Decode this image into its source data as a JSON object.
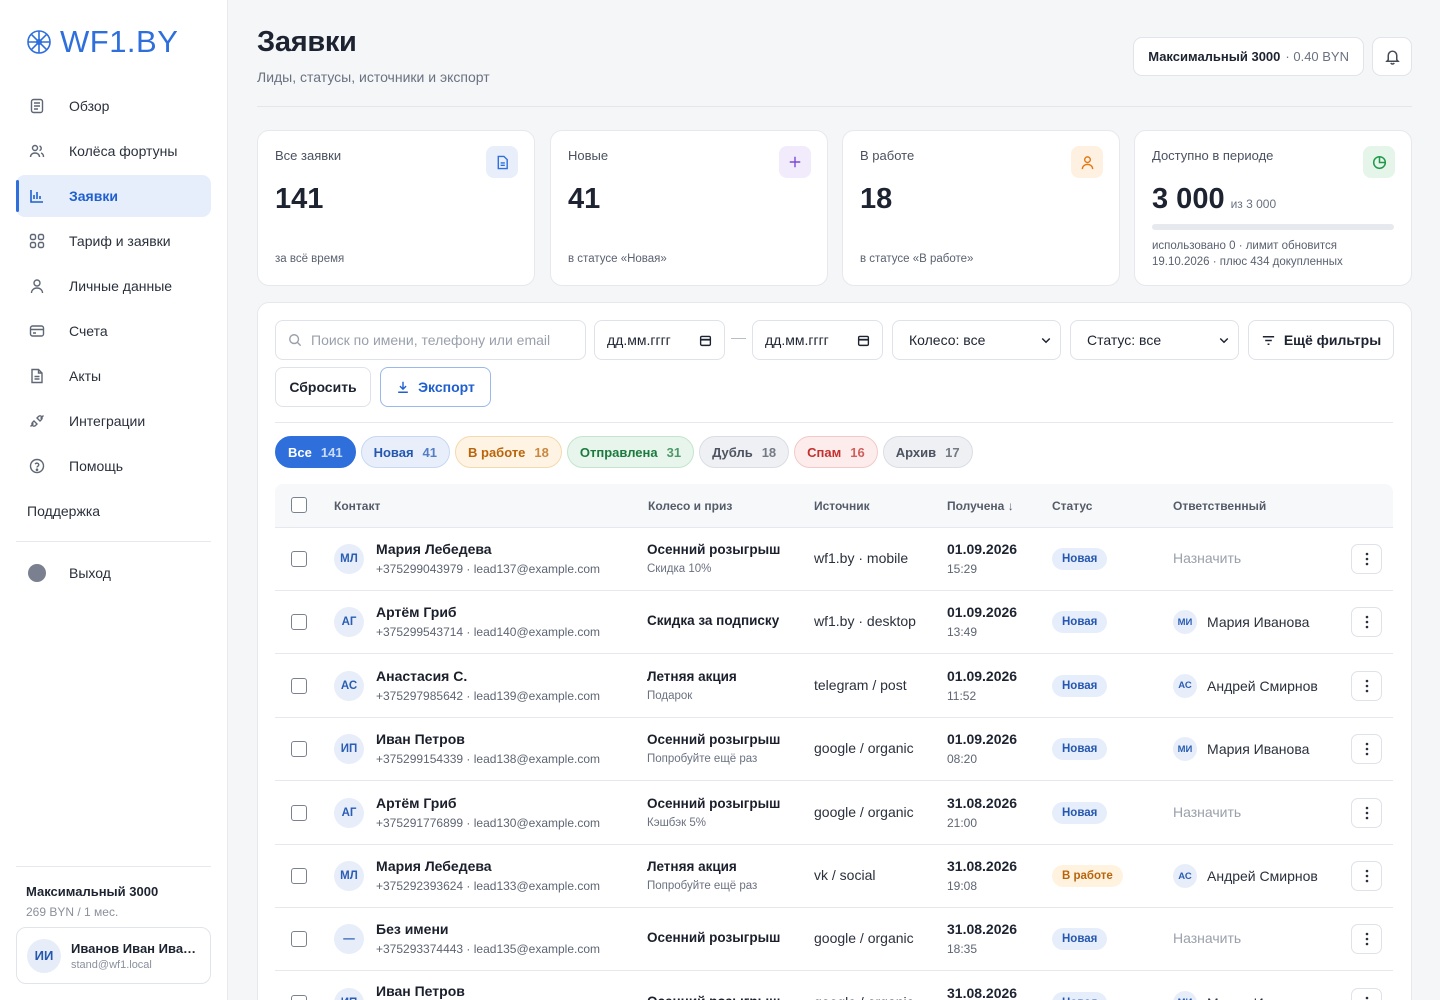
{
  "brand": {
    "name": "WF1.BY"
  },
  "nav": {
    "items": [
      {
        "label": "Обзор",
        "icon": "document-list-icon"
      },
      {
        "label": "Колёса фортуны",
        "icon": "users-icon"
      },
      {
        "label": "Заявки",
        "icon": "bar-chart-icon",
        "active": true
      },
      {
        "label": "Тариф и заявки",
        "icon": "grid-icon"
      },
      {
        "label": "Личные данные",
        "icon": "user-icon"
      },
      {
        "label": "Счета",
        "icon": "credit-card-icon"
      },
      {
        "label": "Акты",
        "icon": "file-icon"
      },
      {
        "label": "Интеграции",
        "icon": "plug-icon"
      },
      {
        "label": "Помощь",
        "icon": "help-circle-icon"
      }
    ],
    "support": "Поддержка",
    "logout": "Выход"
  },
  "sidebar_footer": {
    "plan": "Максимальный 3000",
    "price": "269 BYN / 1 мес.",
    "user": {
      "initials": "ИИ",
      "name": "Иванов Иван Иванович",
      "email": "stand@wf1.local"
    }
  },
  "header": {
    "title": "Заявки",
    "subtitle": "Лиды, статусы, источники и экспорт",
    "plan_name": "Максимальный 3000",
    "plan_price": "· 0.40 BYN"
  },
  "stats": {
    "all": {
      "label": "Все заявки",
      "value": "141",
      "foot": "за всё время"
    },
    "new": {
      "label": "Новые",
      "value": "41",
      "foot": "в статусе «Новая»"
    },
    "work": {
      "label": "В работе",
      "value": "18",
      "foot": "в статусе «В работе»"
    },
    "available": {
      "label": "Доступно в периоде",
      "value": "3 000",
      "of": "из 3 000",
      "usage_fraction": 0.0,
      "foot_line1": "использовано 0 · лимит обновится",
      "foot_line2": "19.10.2026 · плюс 434 докупленных"
    }
  },
  "filters": {
    "search_placeholder": "Поиск по имени, телефону или email",
    "date_from": "дд.мм.гггг",
    "date_to": "дд.мм.гггг",
    "wheel": "Колесо: все",
    "status": "Статус: все",
    "more": "Ещё фильтры",
    "reset": "Сбросить",
    "export": "Экспорт"
  },
  "tabs": [
    {
      "label": "Все",
      "count": "141",
      "bg": "#2f6fdc",
      "fg": "#ffffff",
      "border": "#2f6fdc"
    },
    {
      "label": "Новая",
      "count": "41",
      "bg": "#e8effb",
      "fg": "#2557b0",
      "border": "#c7d8f3"
    },
    {
      "label": "В работе",
      "count": "18",
      "bg": "#fff4e4",
      "fg": "#b8640a",
      "border": "#f3d9ae"
    },
    {
      "label": "Отправлена",
      "count": "31",
      "bg": "#e8f5ec",
      "fg": "#1d7a3e",
      "border": "#c3e5cd"
    },
    {
      "label": "Дубль",
      "count": "18",
      "bg": "#eef0f3",
      "fg": "#4c5360",
      "border": "#dadde3"
    },
    {
      "label": "Спам",
      "count": "16",
      "bg": "#fdecec",
      "fg": "#c2312f",
      "border": "#f3c9c8"
    },
    {
      "label": "Архив",
      "count": "17",
      "bg": "#eef0f3",
      "fg": "#4c5360",
      "border": "#dadde3"
    }
  ],
  "table": {
    "headers": {
      "contact": "Контакт",
      "wheel": "Колесо и приз",
      "source": "Источник",
      "received": "Получена ↓",
      "status": "Статус",
      "owner": "Ответственный"
    },
    "rows": [
      {
        "initials": "МЛ",
        "name": "Мария Лебедева",
        "contact": "+375299043979 · lead137@example.com",
        "wheel": "Осенний розыгрыш",
        "prize": "Скидка 10%",
        "source": "wf1.by · mobile",
        "date": "01.09.2026",
        "time": "15:29",
        "status": "Новая",
        "status_kind": "new",
        "owner": "Назначить",
        "owner_initials": ""
      },
      {
        "initials": "АГ",
        "name": "Артём Гриб",
        "contact": "+375299543714 · lead140@example.com",
        "wheel": "Скидка за подписку",
        "prize": "",
        "source": "wf1.by · desktop",
        "date": "01.09.2026",
        "time": "13:49",
        "status": "Новая",
        "status_kind": "new",
        "owner": "Мария Иванова",
        "owner_initials": "МИ"
      },
      {
        "initials": "АС",
        "name": "Анастасия С.",
        "contact": "+375297985642 · lead139@example.com",
        "wheel": "Летняя акция",
        "prize": "Подарок",
        "source": "telegram / post",
        "date": "01.09.2026",
        "time": "11:52",
        "status": "Новая",
        "status_kind": "new",
        "owner": "Андрей Смирнов",
        "owner_initials": "АС"
      },
      {
        "initials": "ИП",
        "name": "Иван Петров",
        "contact": "+375299154339 · lead138@example.com",
        "wheel": "Осенний розыгрыш",
        "prize": "Попробуйте ещё раз",
        "source": "google / organic",
        "date": "01.09.2026",
        "time": "08:20",
        "status": "Новая",
        "status_kind": "new",
        "owner": "Мария Иванова",
        "owner_initials": "МИ"
      },
      {
        "initials": "АГ",
        "name": "Артём Гриб",
        "contact": "+375291776899 · lead130@example.com",
        "wheel": "Осенний розыгрыш",
        "prize": "Кэшбэк 5%",
        "source": "google / organic",
        "date": "31.08.2026",
        "time": "21:00",
        "status": "Новая",
        "status_kind": "new",
        "owner": "Назначить",
        "owner_initials": ""
      },
      {
        "initials": "МЛ",
        "name": "Мария Лебедева",
        "contact": "+375292393624 · lead133@example.com",
        "wheel": "Летняя акция",
        "prize": "Попробуйте ещё раз",
        "source": "vk / social",
        "date": "31.08.2026",
        "time": "19:08",
        "status": "В работе",
        "status_kind": "work",
        "owner": "Андрей Смирнов",
        "owner_initials": "АС"
      },
      {
        "initials": "—",
        "name": "Без имени",
        "contact": "+375293374443 · lead135@example.com",
        "wheel": "Осенний розыгрыш",
        "prize": "",
        "source": "google / organic",
        "date": "31.08.2026",
        "time": "18:35",
        "status": "Новая",
        "status_kind": "new",
        "owner": "Назначить",
        "owner_initials": ""
      },
      {
        "initials": "ИП",
        "name": "Иван Петров",
        "contact": "",
        "wheel": "Осенний розыгрыш",
        "prize": "",
        "source": "google / organic",
        "date": "31.08.2026",
        "time": "",
        "status": "Новая",
        "status_kind": "new",
        "owner": "Мария Иванова",
        "owner_initials": "МИ"
      }
    ]
  }
}
